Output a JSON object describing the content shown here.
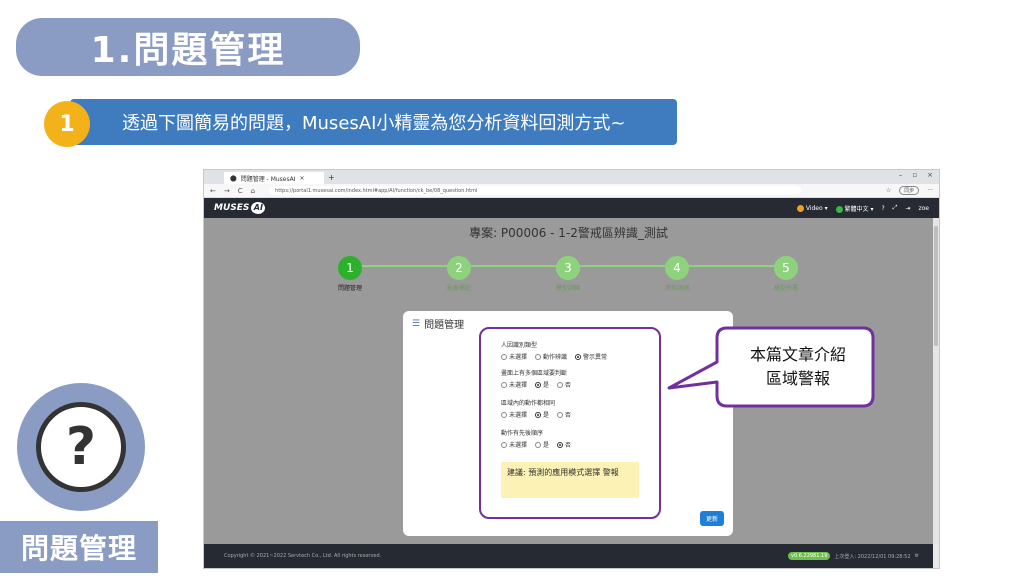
{
  "slide": {
    "title": "1.問題管理",
    "step_number": "1",
    "step_text": "透過下圖簡易的問題，MusesAI小精靈為您分析資料回測方式~",
    "callout_text": "本篇文章介紹\n區域警報",
    "side_label": "問題管理",
    "side_icon": "question-mark-icon",
    "side_icon_char": "?"
  },
  "browser": {
    "tab_title": "問題管理 - MusesAI",
    "tab_plus": "+",
    "window_controls": [
      "–",
      "▫",
      "×"
    ],
    "url": "https://portal1.musesai.com/index.html#app/AI/function/ck_be/08_question.html",
    "sync_label": "同步",
    "nav": [
      "←",
      "→",
      "C",
      "⌂"
    ]
  },
  "app": {
    "logo": "MUSES",
    "logo_ai": "AI",
    "video_label": "Video",
    "lang_label": "繁體中文",
    "help": "?",
    "user": "zoe",
    "project_title": "專案: P00006 - 1-2警戒區辨識_測試",
    "steps": [
      {
        "num": "1",
        "label": "問題管理",
        "active": true
      },
      {
        "num": "2",
        "label": "影像標記",
        "active": false
      },
      {
        "num": "3",
        "label": "模型訓練",
        "active": false
      },
      {
        "num": "4",
        "label": "資料回測",
        "active": false
      },
      {
        "num": "5",
        "label": "模型佈署",
        "active": false
      }
    ],
    "card_title": "問題管理",
    "questions": [
      {
        "label": "人因識別類型",
        "options": [
          "未選擇",
          "動作辨識",
          "警示異常"
        ],
        "selected": 2
      },
      {
        "label": "畫面上有多個區域要判斷",
        "options": [
          "未選擇",
          "是",
          "否"
        ],
        "selected": 1
      },
      {
        "label": "區域內的動作都相同",
        "options": [
          "未選擇",
          "是",
          "否"
        ],
        "selected": 1
      },
      {
        "label": "動作有先後順序",
        "options": [
          "未選擇",
          "是",
          "否"
        ],
        "selected": 2
      }
    ],
    "suggestion": "建議: 預測的應用模式選擇 警報",
    "update_button": "更新",
    "footer_copyright": "Copyright © 2021~2022 Servtech Co., Ltd. All rights reserved.",
    "footer_version": "v0.6.22981.19",
    "footer_login": "上次登入: 2022/12/01 09:28:52"
  }
}
